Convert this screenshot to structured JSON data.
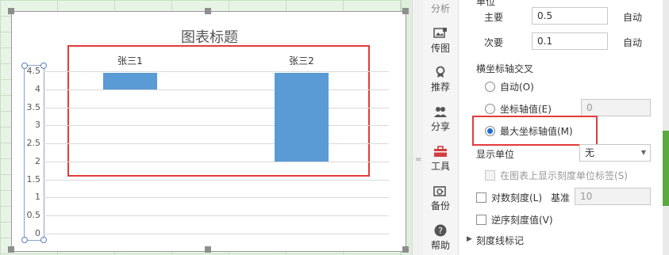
{
  "chart": {
    "title": "图表标题",
    "y_ticks": [
      "4.5",
      "4",
      "3.5",
      "3",
      "2.5",
      "2",
      "1.5",
      "1",
      "0.5",
      "0"
    ]
  },
  "chart_data": {
    "type": "bar",
    "categories": [
      "张三1",
      "张三2"
    ],
    "values": [
      4.5,
      4.5
    ],
    "bar_bottom_values": [
      4.0,
      2.0
    ],
    "ylim": [
      0,
      4.5
    ],
    "grid": true,
    "axis_crosses_at": "max",
    "color": "#5b9bd5"
  },
  "toolbar": {
    "top_label": "分析",
    "items": [
      {
        "label": "传图",
        "icon": "image-upload-icon"
      },
      {
        "label": "推荐",
        "icon": "recommend-icon"
      },
      {
        "label": "分享",
        "icon": "share-icon"
      },
      {
        "label": "工具",
        "icon": "toolbox-icon"
      },
      {
        "label": "备份",
        "icon": "backup-icon"
      },
      {
        "label": "帮助",
        "icon": "help-icon"
      }
    ]
  },
  "panel": {
    "unit_heading": "单位",
    "major_label": "主要",
    "major_value": "0.5",
    "major_auto": "自动",
    "minor_label": "次要",
    "minor_value": "0.1",
    "minor_auto": "自动",
    "cross_heading": "横坐标轴交叉",
    "cross_auto": "自动(O)",
    "cross_axis_value": "坐标轴值(E)",
    "cross_axis_value_input": "0",
    "cross_max": "最大坐标轴值(M)",
    "display_unit_label": "显示单位",
    "display_unit_value": "无",
    "show_unit_label": "在图表上显示刻度单位标签(S)",
    "log_scale": "对数刻度(L)",
    "base_label": "基准",
    "base_value": "10",
    "reverse": "逆序刻度值(V)",
    "tick_marks": "刻度线标记"
  },
  "colors": {
    "bar": "#5b9bd5",
    "highlight": "#e23b3b",
    "accent": "#5aaa3e"
  }
}
